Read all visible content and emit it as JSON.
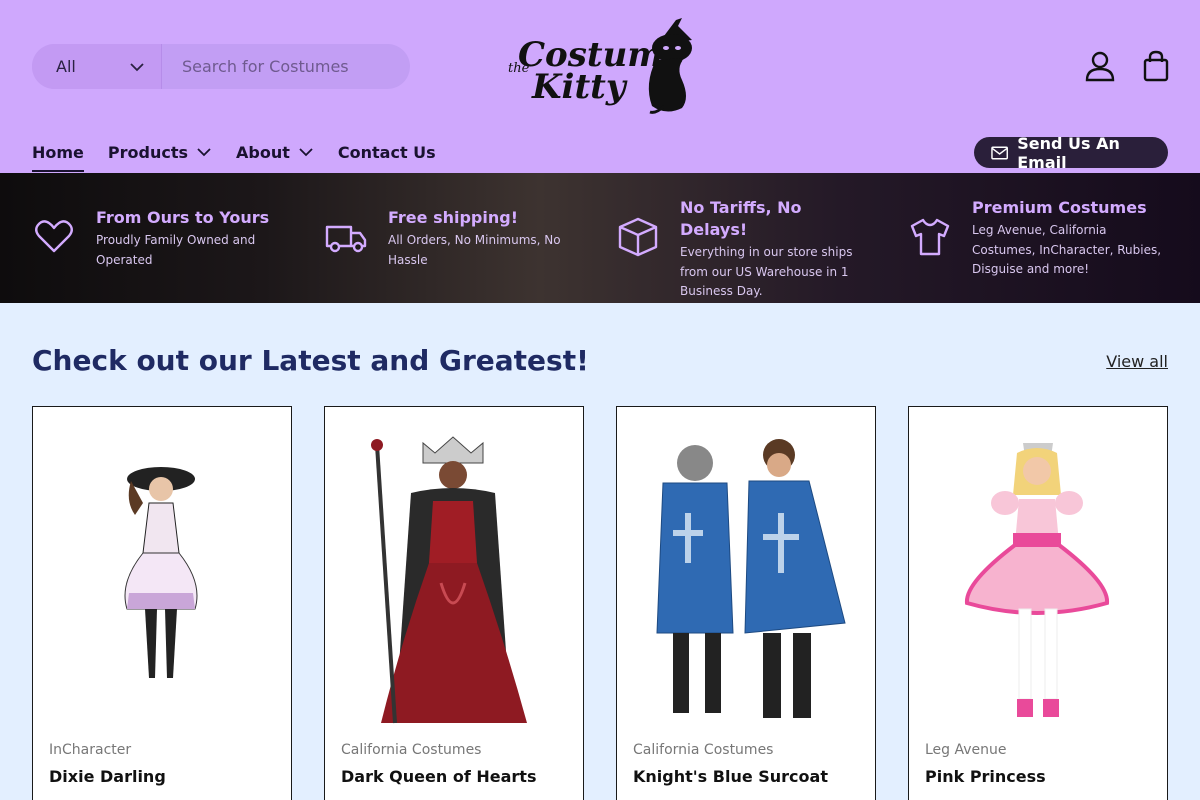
{
  "header": {
    "search": {
      "category": "All",
      "placeholder": "Search for Costumes"
    },
    "logo_text": {
      "the": "the",
      "line1": "Costume",
      "line2": "Kitty"
    },
    "nav": [
      {
        "label": "Home",
        "active": true
      },
      {
        "label": "Products",
        "dropdown": true
      },
      {
        "label": "About",
        "dropdown": true
      },
      {
        "label": "Contact Us"
      }
    ],
    "email_button": "Send Us An Email",
    "icons": [
      "account-icon",
      "cart-bag-icon"
    ]
  },
  "banner": {
    "features": [
      {
        "icon": "heart-icon",
        "title": "From Ours to Yours",
        "description": "Proudly Family Owned and Operated"
      },
      {
        "icon": "truck-icon",
        "title": "Free shipping!",
        "description": "All Orders, No Minimums, No Hassle"
      },
      {
        "icon": "box-icon",
        "title": "No Tariffs, No Delays!",
        "description": "Everything in our store ships from our US Warehouse in 1 Business Day."
      },
      {
        "icon": "tshirt-icon",
        "title": "Premium Costumes",
        "description": "Leg Avenue, California Costumes, InCharacter, Rubies, Disguise and more!"
      }
    ]
  },
  "products": {
    "title": "Check out our Latest and Greatest!",
    "view_all": "View all",
    "items": [
      {
        "brand": "InCharacter",
        "name": "Dixie Darling"
      },
      {
        "brand": "California Costumes",
        "name": "Dark Queen of Hearts"
      },
      {
        "brand": "California Costumes",
        "name": "Knight's Blue Surcoat"
      },
      {
        "brand": "Leg Avenue",
        "name": "Pink Princess"
      }
    ]
  },
  "colors": {
    "header_bg": "#cfa8fd",
    "page_bg": "#e3efff",
    "accent_text": "#d3abff",
    "title_blue": "#1f2a63"
  }
}
